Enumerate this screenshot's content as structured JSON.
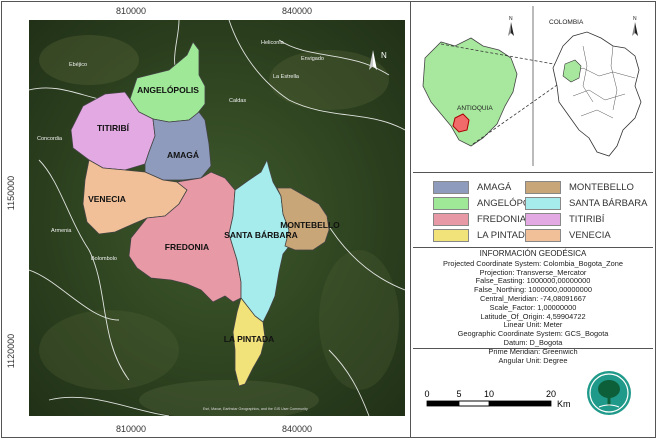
{
  "grid_labels": {
    "x_left": "810000",
    "x_right": "840000",
    "y_upper": "1150000",
    "y_lower": "1120000"
  },
  "municipalities": [
    {
      "name": "AMAGÁ",
      "color": "#8e9bbd"
    },
    {
      "name": "ANGELÓPOLIS",
      "color": "#9ee898"
    },
    {
      "name": "FREDONIA",
      "color": "#e79aa6"
    },
    {
      "name": "LA PINTADA",
      "color": "#f2e27a"
    },
    {
      "name": "MONTEBELLO",
      "color": "#c9a678"
    },
    {
      "name": "SANTA BÁRBARA",
      "color": "#a6ecec"
    },
    {
      "name": "TITIRIBÍ",
      "color": "#e2a9e3"
    },
    {
      "name": "VENECIA",
      "color": "#f1c098"
    }
  ],
  "locator": {
    "country": "COLOMBIA",
    "department": "ANTIOQUIA",
    "north": "N"
  },
  "north_label": "N",
  "geo_info": {
    "title": "INFORMACIÓN GEODÉSICA",
    "lines": [
      "Projected Coordinate System: Colombia_Bogota_Zone",
      "Projection: Transverse_Mercator",
      "False_Easting: 1000000,00000000",
      "False_Northing: 1000000,00000000",
      "Central_Meridian: -74,08091667",
      "Scale_Factor: 1,00000000",
      "Latitude_Of_Origin: 4,59904722",
      "Linear Unit: Meter",
      "Geographic Coordinate System: GCS_Bogota",
      "Datum: D_Bogota",
      "Prime Meridian: Greenwich",
      "Angular Unit: Degree"
    ]
  },
  "scale_bar": {
    "ticks": [
      "0",
      "5",
      "10",
      "20"
    ],
    "unit": "Km"
  },
  "map_places": [
    "Heliconia",
    "Ebéjico",
    "Envigado",
    "Caldas",
    "La Estrella",
    "Armenia",
    "Bolombolo",
    "Concordia"
  ],
  "attribution": "Esri, Maxar, Earthstar Geographics, and the GIS User Community"
}
